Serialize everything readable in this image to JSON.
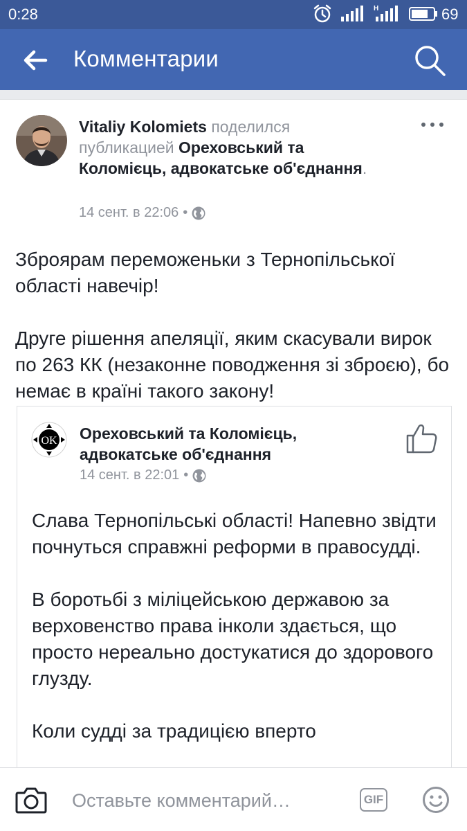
{
  "status_bar": {
    "time": "0:28",
    "battery": "69"
  },
  "app_bar": {
    "title": "Комментарии"
  },
  "post": {
    "author": "Vitaliy Kolomiets",
    "action_text": "поделился публикацией",
    "shared_page": "Ореховський та Коломієць, адвокатське об'єднання",
    "period": ".",
    "timestamp": "14 сент. в 22:06",
    "separator": "•",
    "paragraphs": [
      "Зброярам переможеньки з Тернопільської області навечір!",
      "Друге рішення апеляції, яким скасували вирок по 263 КК (незаконне поводження зі зброєю), бо немає в країні такого закону!"
    ]
  },
  "shared_post": {
    "page_name": "Ореховський та Коломієць, адвокатське об'єднання",
    "logo_text": "OK",
    "timestamp": "14 сент. в 22:01",
    "separator": "•",
    "paragraphs": [
      "Слава Тернопільські області! Напевно звідти почнуться справжні реформи в правосудді.",
      "В боротьбі з міліцейською державою за верховенство права  інколи здається, що просто нереально достукатися до здорового глузду.",
      "Коли судді за традицією вперто"
    ]
  },
  "comment_bar": {
    "placeholder": "Оставьте комментарий…",
    "gif_label": "GIF"
  },
  "colors": {
    "status_bar": "#3b5998",
    "app_bar": "#4267b2",
    "meta_gray": "#90949c",
    "text": "#1d2129"
  },
  "icons": [
    "back-arrow-icon",
    "search-icon",
    "alarm-icon",
    "signal-icon",
    "battery-icon",
    "more-icon",
    "globe-icon",
    "like-icon",
    "camera-icon",
    "gif-icon",
    "smile-icon"
  ]
}
